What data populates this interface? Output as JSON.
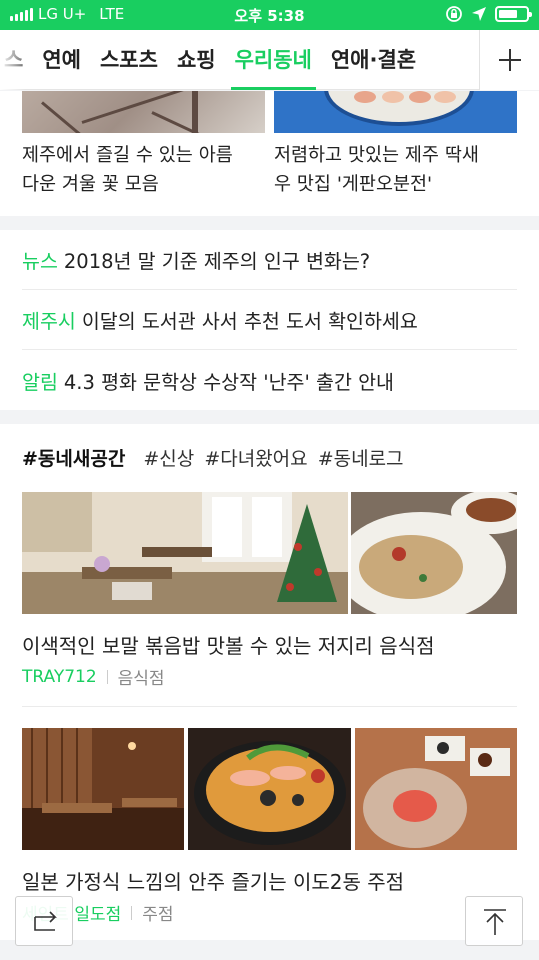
{
  "status_bar": {
    "carrier": "LG U+",
    "network": "LTE",
    "time": "오후 5:38"
  },
  "tabs": [
    {
      "label": "스"
    },
    {
      "label": "연예"
    },
    {
      "label": "스포츠"
    },
    {
      "label": "쇼핑"
    },
    {
      "label": "우리동네"
    },
    {
      "label": "연애·결혼"
    }
  ],
  "active_tab": "우리동네",
  "top_cards": [
    {
      "title_line1": "제주에서 즐길 수 있는 아름",
      "title_line2": "다운 겨울 꽃 모음"
    },
    {
      "title_line1": "저렴하고 맛있는 제주 딱새",
      "title_line2": "우 맛집 '게판오분전'"
    }
  ],
  "news": [
    {
      "category": "뉴스",
      "text": "2018년 말 기준 제주의 인구 변화는?"
    },
    {
      "category": "제주시",
      "text": "이달의 도서관 사서 추천 도서 확인하세요"
    },
    {
      "category": "알림",
      "text": "4.3 평화 문학상 수상작 '난주' 출간 안내"
    }
  ],
  "hashtags": {
    "main": "#동네새공간",
    "others": [
      "#신상",
      "#다녀왔어요",
      "#동네로그"
    ]
  },
  "posts": [
    {
      "title": "이색적인 보말 볶음밥 맛볼 수 있는 저지리 음식점",
      "source": "TRAY712",
      "category": "음식점"
    },
    {
      "title": "일본 가정식 느낌의 안주 즐기는 이도2동 주점",
      "source": "세인트 일도점",
      "category": "주점"
    }
  ],
  "colors": {
    "accent": "#19ce60",
    "text": "#222222",
    "meta": "#888888",
    "background": "#f2f3f5"
  },
  "icons": {
    "add_tab": "plus-icon",
    "share": "share-icon",
    "scroll_top": "scroll-to-top-icon"
  }
}
